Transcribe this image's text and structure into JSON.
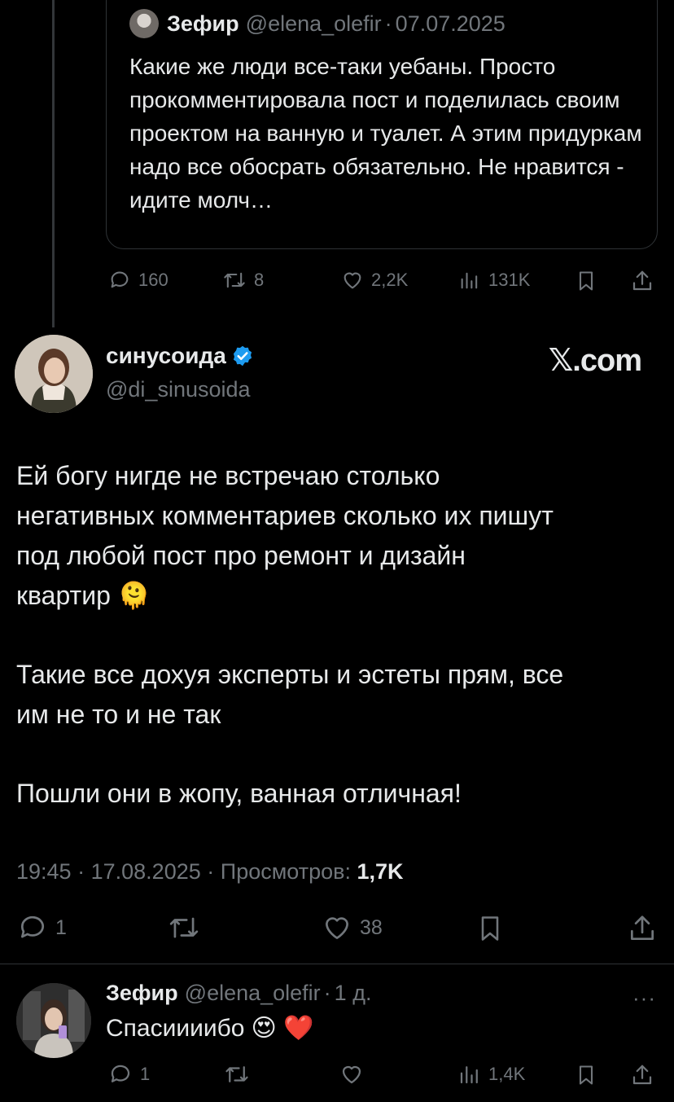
{
  "quoted_tweet": {
    "author_name": "Зефир",
    "author_handle": "@elena_olefir",
    "separator": "·",
    "date": "07.07.2025",
    "text": "Какие же люди все-таки уебаны. Просто прокомментировала пост и поделилась своим проектом на ванную и туалет. А этим придуркам надо все обосрать обязательно. Не нравится - идите молч…",
    "replies": "160",
    "reposts": "8",
    "likes": "2,2K",
    "views": "131K"
  },
  "main_tweet": {
    "author_name": "синусоида",
    "author_handle": "@di_sinusoida",
    "verified": true,
    "source_label": "𝕏.com",
    "paragraph_1_line_1": "Ей богу нигде не встречаю столько",
    "paragraph_1_line_2": "негативных комментариев сколько их пишут",
    "paragraph_1_line_3": "под любой пост про ремонт и дизайн",
    "paragraph_1_line_4": "квартир",
    "paragraph_1_emoji": "🫠",
    "paragraph_2_line_1": "Такие все дохуя эксперты и эстеты прям, все",
    "paragraph_2_line_2": "им не то и не так",
    "paragraph_3": "Пошли они в жопу, ванная отличная!",
    "time": "19:45",
    "date": "17.08.2025",
    "views_label": "Просмотров:",
    "views": "1,7K",
    "replies": "1",
    "likes": "38"
  },
  "reply_tweet": {
    "author_name": "Зефир",
    "author_handle": "@elena_olefir",
    "age": "1 д.",
    "text": "Спасиииибо",
    "emojis": "😍 ❤️",
    "replies": "1",
    "views": "1,4K",
    "more": "···"
  },
  "colors": {
    "background": "#000000",
    "text": "#e7e9ea",
    "secondary": "#71767b",
    "verified_badge": "#1d9bf0",
    "border": "#2f3336"
  }
}
